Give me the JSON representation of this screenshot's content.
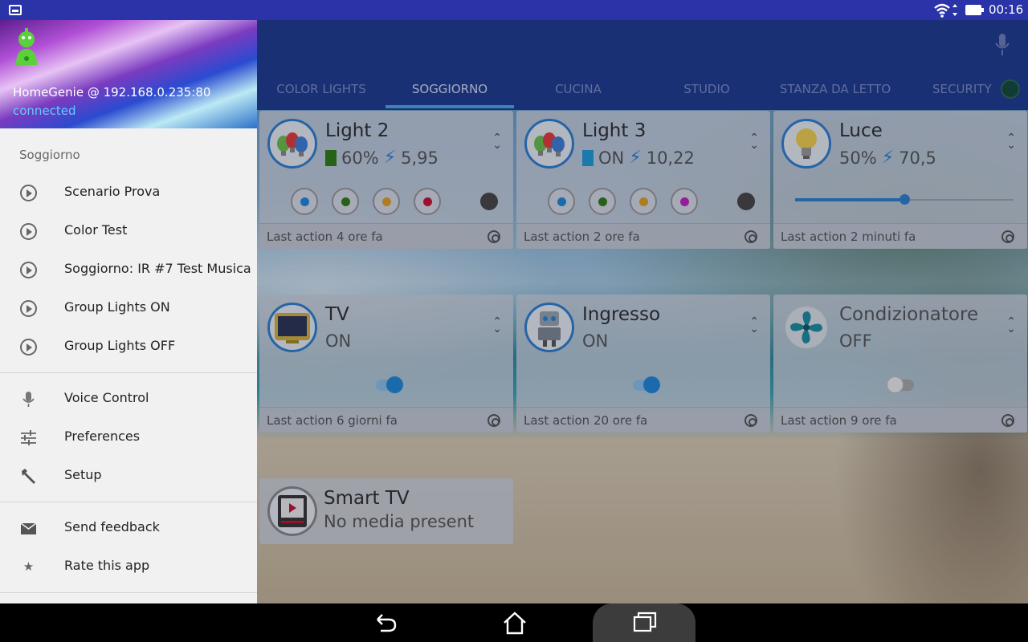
{
  "status_bar": {
    "time": "00:16"
  },
  "app": {
    "tabs": [
      {
        "label": "COLOR LIGHTS",
        "active": false
      },
      {
        "label": "SOGGIORNO",
        "active": true
      },
      {
        "label": "CUCINA",
        "active": false
      },
      {
        "label": "STUDIO",
        "active": false
      },
      {
        "label": "STANZA DA LETTO",
        "active": false
      },
      {
        "label": "SECURITY",
        "active": false
      }
    ]
  },
  "drawer": {
    "host": "HomeGenie @ 192.168.0.235:80",
    "connection": "connected",
    "section": "Soggiorno",
    "scenarios": [
      {
        "label": "Scenario Prova",
        "icon": "play-circle-icon"
      },
      {
        "label": "Color Test",
        "icon": "play-circle-icon"
      },
      {
        "label": "Soggiorno: IR #7 Test Musica",
        "icon": "play-circle-icon"
      },
      {
        "label": "Group Lights ON",
        "icon": "play-circle-icon"
      },
      {
        "label": "Group Lights OFF",
        "icon": "play-circle-icon"
      }
    ],
    "tools": [
      {
        "label": "Voice Control",
        "icon": "mic-icon"
      },
      {
        "label": "Preferences",
        "icon": "sliders-icon"
      },
      {
        "label": "Setup",
        "icon": "wrench-icon"
      }
    ],
    "misc": [
      {
        "label": "Send feedback",
        "icon": "mail-icon"
      },
      {
        "label": "Rate this app",
        "icon": "star-icon"
      }
    ]
  },
  "cards": {
    "light2": {
      "title": "Light 2",
      "level": "60%",
      "power": "5,95",
      "last": "Last action 4 ore fa",
      "level_color": "#2e7d12",
      "colors": [
        "#1e88d8",
        "#2e7d12",
        "#e0a020",
        "#c8102e"
      ]
    },
    "light3": {
      "title": "Light 3",
      "level": "ON",
      "power": "10,22",
      "last": "Last action 2 ore fa",
      "level_color": "#1e9bd8",
      "colors": [
        "#1e88d8",
        "#2e7d12",
        "#e0a020",
        "#c020c0"
      ]
    },
    "luce": {
      "title": "Luce",
      "level": "50%",
      "power": "70,5",
      "last": "Last action 2 minuti fa",
      "slider_value": 0.5
    },
    "tv": {
      "title": "TV",
      "status": "ON",
      "last": "Last action 6 giorni fa",
      "switch_on": true
    },
    "ingresso": {
      "title": "Ingresso",
      "status": "ON",
      "last": "Last action 20 ore fa",
      "switch_on": true
    },
    "condizionatore": {
      "title": "Condizionatore",
      "status": "OFF",
      "last": "Last action 9 ore fa",
      "switch_on": false
    },
    "smarttv": {
      "title": "Smart TV",
      "status": "No media present"
    }
  },
  "colors": {
    "accent": "#2d7fd1",
    "appbar": "#1d3a8f",
    "statusbar": "#2a34a8",
    "connected": "#5fd0ff"
  }
}
